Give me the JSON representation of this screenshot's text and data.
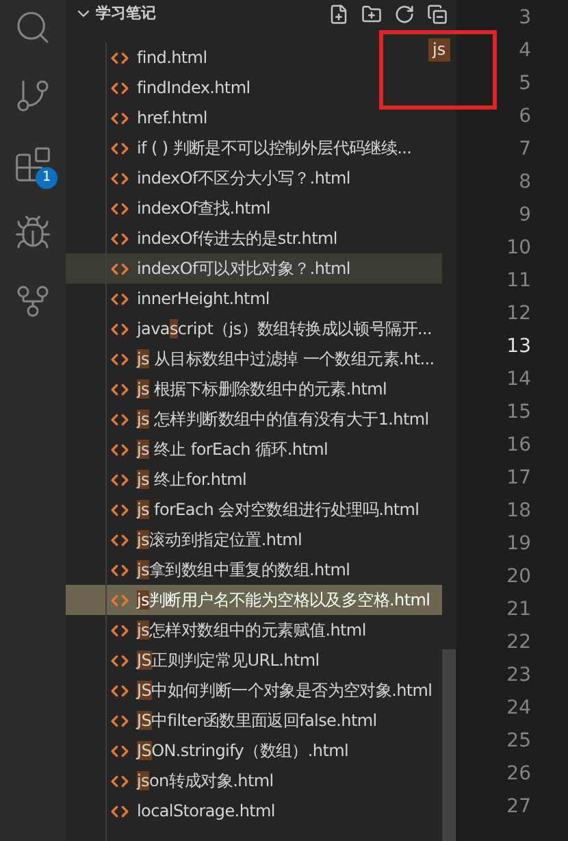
{
  "activity_bar": [
    {
      "kind": "search"
    },
    {
      "kind": "source-control"
    },
    {
      "kind": "extensions",
      "badge": "1"
    },
    {
      "kind": "debug"
    },
    {
      "kind": "graph"
    }
  ],
  "explorer": {
    "title": "学习笔记",
    "expanded": true
  },
  "files": [
    {
      "parts": [
        {
          "text": "find.html",
          "match": false
        }
      ],
      "selected": false,
      "hovered": false
    },
    {
      "parts": [
        {
          "text": "findIndex.html",
          "match": false
        }
      ],
      "selected": false,
      "hovered": false
    },
    {
      "parts": [
        {
          "text": "href.html",
          "match": false
        }
      ],
      "selected": false,
      "hovered": false
    },
    {
      "parts": [
        {
          "text": "if ( ) 判断是不可以控制外层代码继续...",
          "match": false
        }
      ],
      "selected": false,
      "hovered": false
    },
    {
      "parts": [
        {
          "text": "indexOf不区分大小写？.html",
          "match": false
        }
      ],
      "selected": false,
      "hovered": false
    },
    {
      "parts": [
        {
          "text": "indexOf查找.html",
          "match": false
        }
      ],
      "selected": false,
      "hovered": false
    },
    {
      "parts": [
        {
          "text": "indexOf传进去的是str.html",
          "match": false
        }
      ],
      "selected": false,
      "hovered": false
    },
    {
      "parts": [
        {
          "text": "indexOf可以对比对象？.html",
          "match": false
        }
      ],
      "selected": false,
      "hovered": true
    },
    {
      "parts": [
        {
          "text": "innerHeight.html",
          "match": false
        }
      ],
      "selected": false,
      "hovered": false
    },
    {
      "parts": [
        {
          "text": "java",
          "match": false
        },
        {
          "text": "s",
          "match": true
        },
        {
          "text": "cript（js）数组转换成以顿号隔开...",
          "match": false
        }
      ],
      "selected": false,
      "hovered": false
    },
    {
      "parts": [
        {
          "text": "js",
          "match": true
        },
        {
          "text": " 从目标数组中过滤掉 一个数组元素.ht...",
          "match": false
        }
      ],
      "selected": false,
      "hovered": false
    },
    {
      "parts": [
        {
          "text": "js",
          "match": true
        },
        {
          "text": " 根据下标删除数组中的元素.html",
          "match": false
        }
      ],
      "selected": false,
      "hovered": false
    },
    {
      "parts": [
        {
          "text": "js",
          "match": true
        },
        {
          "text": " 怎样判断数组中的值有没有大于1.html",
          "match": false
        }
      ],
      "selected": false,
      "hovered": false
    },
    {
      "parts": [
        {
          "text": "js",
          "match": true
        },
        {
          "text": " 终止 forEach 循环.html",
          "match": false
        }
      ],
      "selected": false,
      "hovered": false
    },
    {
      "parts": [
        {
          "text": "js",
          "match": true
        },
        {
          "text": " 终止for.html",
          "match": false
        }
      ],
      "selected": false,
      "hovered": false
    },
    {
      "parts": [
        {
          "text": "js",
          "match": true
        },
        {
          "text": " forEach 会对空数组进行处理吗.html",
          "match": false
        }
      ],
      "selected": false,
      "hovered": false
    },
    {
      "parts": [
        {
          "text": "js",
          "match": true
        },
        {
          "text": "滚动到指定位置.html",
          "match": false
        }
      ],
      "selected": false,
      "hovered": false
    },
    {
      "parts": [
        {
          "text": "js",
          "match": true
        },
        {
          "text": "拿到数组中重复的数组.html",
          "match": false
        }
      ],
      "selected": false,
      "hovered": false
    },
    {
      "parts": [
        {
          "text": "js",
          "match": true
        },
        {
          "text": "判断用户名不能为空格以及多空格.html",
          "match": false
        }
      ],
      "selected": true,
      "hovered": false
    },
    {
      "parts": [
        {
          "text": "js",
          "match": true
        },
        {
          "text": "怎样对数组中的元素赋值.html",
          "match": false
        }
      ],
      "selected": false,
      "hovered": false
    },
    {
      "parts": [
        {
          "text": "JS",
          "match": true
        },
        {
          "text": "正则判定常见URL.html",
          "match": false
        }
      ],
      "selected": false,
      "hovered": false
    },
    {
      "parts": [
        {
          "text": "JS",
          "match": true
        },
        {
          "text": "中如何判断一个对象是否为空对象.html",
          "match": false
        }
      ],
      "selected": false,
      "hovered": false
    },
    {
      "parts": [
        {
          "text": "JS",
          "match": true
        },
        {
          "text": "中filter函数里面返回false.html",
          "match": false
        }
      ],
      "selected": false,
      "hovered": false
    },
    {
      "parts": [
        {
          "text": "JS",
          "match": true
        },
        {
          "text": "ON.stringify（数组）.html",
          "match": false
        }
      ],
      "selected": false,
      "hovered": false
    },
    {
      "parts": [
        {
          "text": "js",
          "match": true
        },
        {
          "text": "on转成对象.html",
          "match": false
        }
      ],
      "selected": false,
      "hovered": false
    },
    {
      "parts": [
        {
          "text": "localStorage.html",
          "match": false
        }
      ],
      "selected": false,
      "hovered": false
    }
  ],
  "filter_badge": {
    "text": "js"
  },
  "editor": {
    "line_numbers": [
      {
        "text": "3",
        "current": false
      },
      {
        "text": "4",
        "current": false
      },
      {
        "text": "5",
        "current": false
      },
      {
        "text": "6",
        "current": false
      },
      {
        "text": "7",
        "current": false
      },
      {
        "text": "8",
        "current": false
      },
      {
        "text": "9",
        "current": false
      },
      {
        "text": "10",
        "current": false
      },
      {
        "text": "11",
        "current": false
      },
      {
        "text": "12",
        "current": false
      },
      {
        "text": "13",
        "current": true
      },
      {
        "text": "14",
        "current": false
      },
      {
        "text": "15",
        "current": false
      },
      {
        "text": "16",
        "current": false
      },
      {
        "text": "17",
        "current": false
      },
      {
        "text": "18",
        "current": false
      },
      {
        "text": "19",
        "current": false
      },
      {
        "text": "20",
        "current": false
      },
      {
        "text": "21",
        "current": false
      },
      {
        "text": "22",
        "current": false
      },
      {
        "text": "23",
        "current": false
      },
      {
        "text": "24",
        "current": false
      },
      {
        "text": "25",
        "current": false
      },
      {
        "text": "26",
        "current": false
      },
      {
        "text": "27",
        "current": false
      }
    ]
  }
}
